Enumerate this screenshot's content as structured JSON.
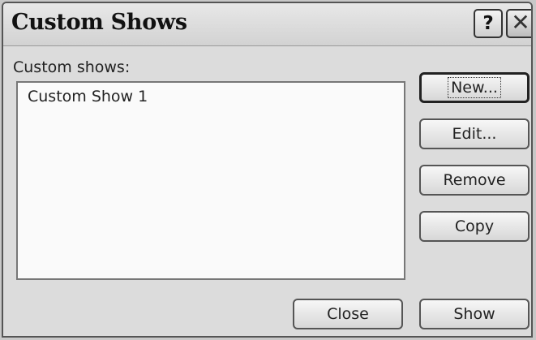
{
  "dialog": {
    "title": "Custom Shows",
    "help_glyph": "?",
    "close_glyph": "✕"
  },
  "list": {
    "label": "Custom shows:",
    "items": [
      "Custom Show 1"
    ]
  },
  "buttons": {
    "new": "New...",
    "edit": "Edit...",
    "remove": "Remove",
    "copy": "Copy",
    "close": "Close",
    "show": "Show"
  },
  "icons": {
    "help": "help-icon",
    "close": "close-icon"
  }
}
